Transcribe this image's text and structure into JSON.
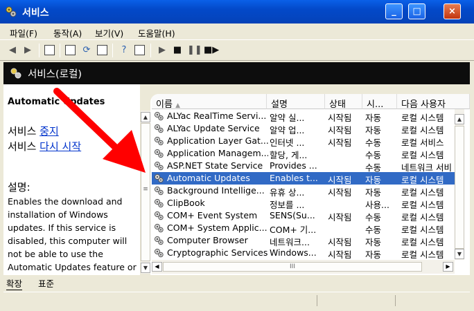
{
  "window": {
    "title": "서비스",
    "min": "_",
    "max": "□",
    "close": "×"
  },
  "menu": [
    "파일(F)",
    "동작(A)",
    "보기(V)",
    "도움말(H)"
  ],
  "panel": {
    "header": "서비스(로컬)"
  },
  "left": {
    "service_title": "Automatic Updates",
    "action1_prefix": "서비스 ",
    "action1_link": "중지",
    "action2_prefix": "서비스 ",
    "action2_link": "다시 시작",
    "desc_label": "설명:",
    "desc_text": "Enables the download and installation of Windows updates. If this service is disabled, this computer will not be able to use the Automatic Updates feature or"
  },
  "columns": [
    "이름",
    "설명",
    "상태",
    "시...",
    "다음 사용자"
  ],
  "rows": [
    {
      "name": "ALYac RealTime Servi...",
      "desc": "알약 실...",
      "status": "시작됨",
      "start": "자동",
      "user": "로컬 시스템"
    },
    {
      "name": "ALYac Update Service",
      "desc": "알약 업...",
      "status": "시작됨",
      "start": "자동",
      "user": "로컬 시스템"
    },
    {
      "name": "Application Layer Gat...",
      "desc": "인터넷 ...",
      "status": "시작됨",
      "start": "수동",
      "user": "로컬 서비스"
    },
    {
      "name": "Application Managem...",
      "desc": "할당, 게...",
      "status": "",
      "start": "수동",
      "user": "로컬 시스템"
    },
    {
      "name": "ASP.NET State Service",
      "desc": "Provides ...",
      "status": "",
      "start": "수동",
      "user": "네트워크 서비"
    },
    {
      "name": "Automatic Updates",
      "desc": "Enables t...",
      "status": "시작됨",
      "start": "자동",
      "user": "로컬 시스템"
    },
    {
      "name": "Background Intellige...",
      "desc": "유휴 상...",
      "status": "시작됨",
      "start": "자동",
      "user": "로컬 시스템"
    },
    {
      "name": "ClipBook",
      "desc": "정보를 ...",
      "status": "",
      "start": "사용...",
      "user": "로컬 시스템"
    },
    {
      "name": "COM+ Event System",
      "desc": "SENS(Su...",
      "status": "시작됨",
      "start": "수동",
      "user": "로컬 시스템"
    },
    {
      "name": "COM+ System Applic...",
      "desc": "COM+ 기...",
      "status": "",
      "start": "수동",
      "user": "로컬 시스템"
    },
    {
      "name": "Computer Browser",
      "desc": "네트워크...",
      "status": "시작됨",
      "start": "자동",
      "user": "로컬 시스템"
    },
    {
      "name": "Cryptographic Services",
      "desc": "Windows...",
      "status": "시작됨",
      "start": "자동",
      "user": "로컬 시스템"
    }
  ],
  "selected_row": 5,
  "scroll": {
    "h_grip": "III",
    "left_grip": "≡"
  },
  "tabs": [
    "확장",
    "표준"
  ],
  "colors": {
    "title_bar": "#0349c9",
    "selection": "#316ac5",
    "annotation_arrow": "#ff0000"
  }
}
